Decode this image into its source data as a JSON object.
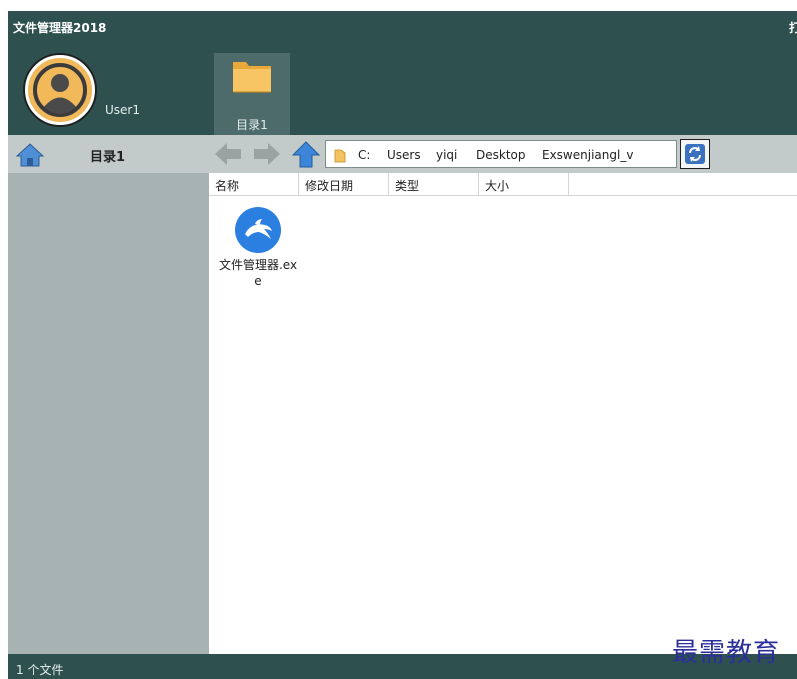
{
  "window": {
    "title": "文件管理器2018",
    "title_right": "打"
  },
  "user": {
    "name": "User1"
  },
  "tabs": [
    {
      "label": "目录1"
    }
  ],
  "nav": {
    "dir_title": "目录1"
  },
  "address": {
    "crumbs": [
      "C:",
      "Users",
      "yiqi",
      "Desktop",
      "Exswenjiangl_v"
    ]
  },
  "columns": [
    "名称",
    "修改日期",
    "类型",
    "大小"
  ],
  "files": [
    {
      "name": "文件管理器.exe",
      "icon": "dolphin-app-icon"
    }
  ],
  "status": {
    "text": "1 个文件"
  },
  "watermark": "最需教育",
  "colors": {
    "frame": "#2e5150",
    "sidebar": "#a6b3b2",
    "navbar": "#c2cbca",
    "accent": "#2a7fe0"
  }
}
